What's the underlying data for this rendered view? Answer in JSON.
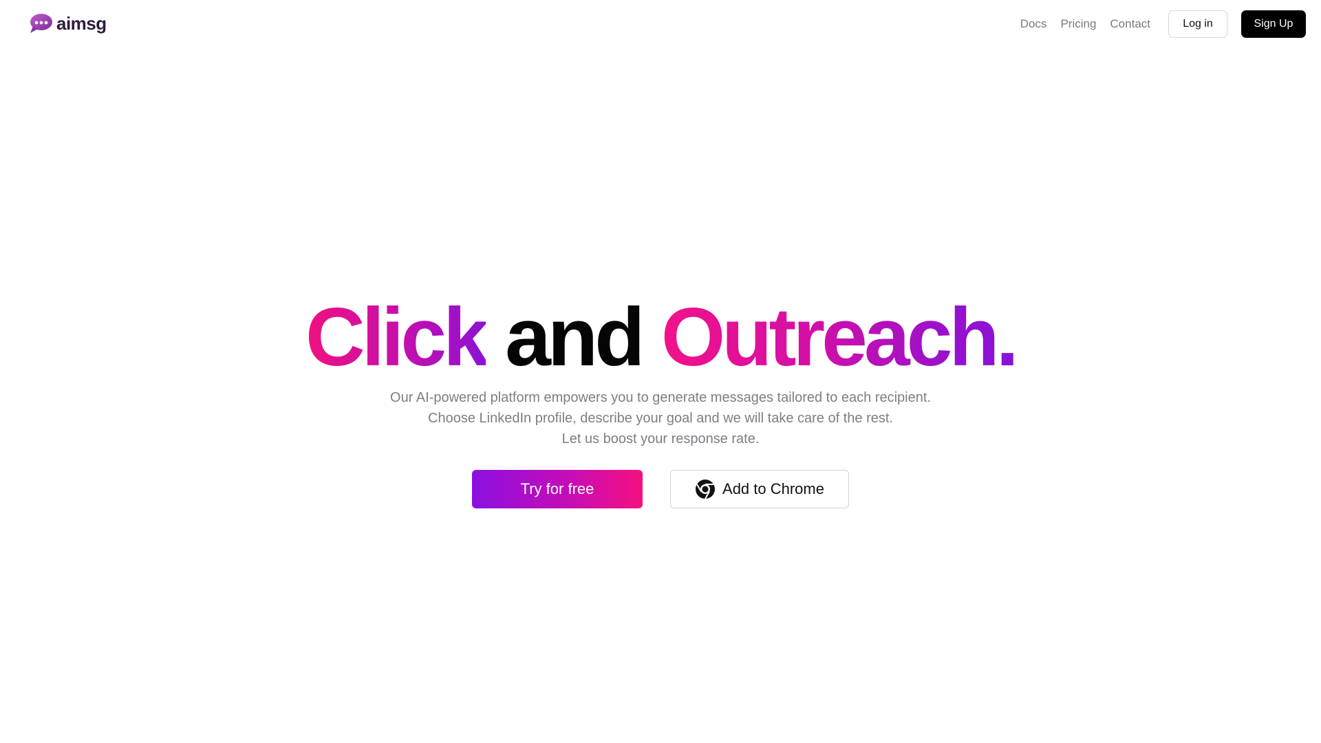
{
  "brand": {
    "name": "aimsg",
    "logo_icon": "chat-bubble-logo-icon",
    "logo_color": "#a23bb8"
  },
  "nav": {
    "links": [
      "Docs",
      "Pricing",
      "Contact"
    ],
    "login_label": "Log in",
    "signup_label": "Sign Up"
  },
  "hero": {
    "title_parts": [
      "Click",
      "and",
      "Outreach",
      "."
    ],
    "subtitle_lines": [
      "Our AI-powered platform empowers you to generate messages tailored to each recipient.",
      "Choose LinkedIn profile, describe your goal and we will take care of the rest.",
      "Let us boost your response rate."
    ],
    "primary_cta": "Try for free",
    "secondary_cta": "Add to Chrome",
    "secondary_cta_icon": "chrome-icon"
  },
  "colors": {
    "gradient_pink": "#f0117f",
    "gradient_purple": "#8a12d6",
    "text_gray": "#7d7d85",
    "signup_bg": "#000000"
  }
}
